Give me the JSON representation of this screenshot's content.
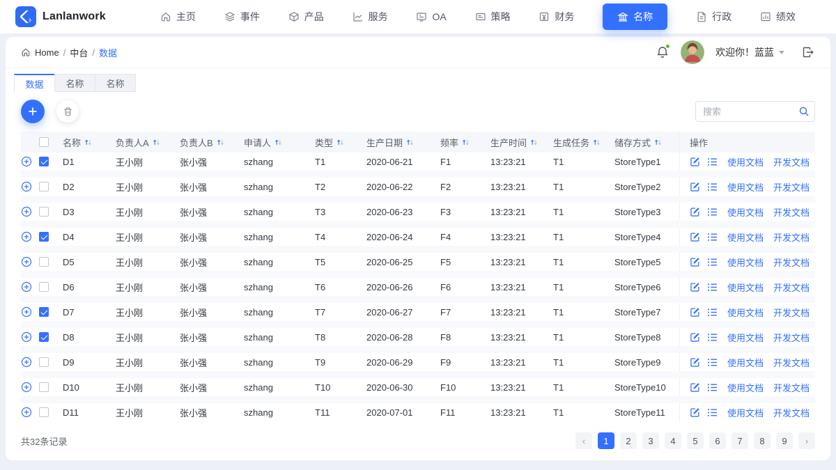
{
  "colors": {
    "primary": "#3370ff",
    "notification_dot": "#52c41a"
  },
  "brand": {
    "name": "Lanlanwork",
    "logo_icon": "brand-logo-icon"
  },
  "nav": {
    "items": [
      {
        "label": "主页",
        "icon": "home-icon",
        "active": false
      },
      {
        "label": "事件",
        "icon": "layers-icon",
        "active": false
      },
      {
        "label": "产品",
        "icon": "cube-icon",
        "active": false
      },
      {
        "label": "服务",
        "icon": "trend-icon",
        "active": false
      },
      {
        "label": "OA",
        "icon": "monitor-icon",
        "active": false
      },
      {
        "label": "策略",
        "icon": "note-icon",
        "active": false
      },
      {
        "label": "财务",
        "icon": "finance-icon",
        "active": false
      },
      {
        "label": "名称",
        "icon": "bank-icon",
        "active": true
      },
      {
        "label": "行政",
        "icon": "doc-icon",
        "active": false
      },
      {
        "label": "绩效",
        "icon": "stats-icon",
        "active": false
      }
    ]
  },
  "header": {
    "breadcrumb": {
      "home": "Home",
      "sep": "/",
      "section": "中台",
      "current": "数据"
    },
    "welcome": "欢迎你！蓝蓝"
  },
  "tabs": [
    {
      "label": "数据",
      "active": true
    },
    {
      "label": "名称",
      "active": false
    },
    {
      "label": "名称",
      "active": false
    }
  ],
  "toolbar": {
    "search_placeholder": "搜索"
  },
  "table": {
    "columns": [
      {
        "label": "名称",
        "sortable": true
      },
      {
        "label": "负责人A",
        "sortable": true
      },
      {
        "label": "负责人B",
        "sortable": true
      },
      {
        "label": "申请人",
        "sortable": true
      },
      {
        "label": "类型",
        "sortable": true
      },
      {
        "label": "生产日期",
        "sortable": true
      },
      {
        "label": "频率",
        "sortable": true
      },
      {
        "label": "生产时间",
        "sortable": true
      },
      {
        "label": "生成任务",
        "sortable": true
      },
      {
        "label": "储存方式",
        "sortable": true
      }
    ],
    "op_column": "操作",
    "op_links": [
      "使用文档",
      "开发文档"
    ],
    "rows": [
      {
        "checked": true,
        "name": "D1",
        "owner_a": "王小刚",
        "owner_b": "张小强",
        "applicant": "szhang",
        "type": "T1",
        "prod_date": "2020-06-21",
        "freq": "F1",
        "prod_time": "13:23:21",
        "task": "T1",
        "store": "StoreType1"
      },
      {
        "checked": false,
        "name": "D2",
        "owner_a": "王小刚",
        "owner_b": "张小强",
        "applicant": "szhang",
        "type": "T2",
        "prod_date": "2020-06-22",
        "freq": "F2",
        "prod_time": "13:23:21",
        "task": "T1",
        "store": "StoreType2"
      },
      {
        "checked": false,
        "name": "D3",
        "owner_a": "王小刚",
        "owner_b": "张小强",
        "applicant": "szhang",
        "type": "T3",
        "prod_date": "2020-06-23",
        "freq": "F3",
        "prod_time": "13:23:21",
        "task": "T1",
        "store": "StoreType3"
      },
      {
        "checked": true,
        "name": "D4",
        "owner_a": "王小刚",
        "owner_b": "张小强",
        "applicant": "szhang",
        "type": "T4",
        "prod_date": "2020-06-24",
        "freq": "F4",
        "prod_time": "13:23:21",
        "task": "T1",
        "store": "StoreType4"
      },
      {
        "checked": false,
        "name": "D5",
        "owner_a": "王小刚",
        "owner_b": "张小强",
        "applicant": "szhang",
        "type": "T5",
        "prod_date": "2020-06-25",
        "freq": "F5",
        "prod_time": "13:23:21",
        "task": "T1",
        "store": "StoreType5"
      },
      {
        "checked": false,
        "name": "D6",
        "owner_a": "王小刚",
        "owner_b": "张小强",
        "applicant": "szhang",
        "type": "T6",
        "prod_date": "2020-06-26",
        "freq": "F6",
        "prod_time": "13:23:21",
        "task": "T1",
        "store": "StoreType6"
      },
      {
        "checked": true,
        "name": "D7",
        "owner_a": "王小刚",
        "owner_b": "张小强",
        "applicant": "szhang",
        "type": "T7",
        "prod_date": "2020-06-27",
        "freq": "F7",
        "prod_time": "13:23:21",
        "task": "T1",
        "store": "StoreType7"
      },
      {
        "checked": true,
        "name": "D8",
        "owner_a": "王小刚",
        "owner_b": "张小强",
        "applicant": "szhang",
        "type": "T8",
        "prod_date": "2020-06-28",
        "freq": "F8",
        "prod_time": "13:23:21",
        "task": "T1",
        "store": "StoreType8"
      },
      {
        "checked": false,
        "name": "D9",
        "owner_a": "王小刚",
        "owner_b": "张小强",
        "applicant": "szhang",
        "type": "T9",
        "prod_date": "2020-06-29",
        "freq": "F9",
        "prod_time": "13:23:21",
        "task": "T1",
        "store": "StoreType9"
      },
      {
        "checked": false,
        "name": "D10",
        "owner_a": "王小刚",
        "owner_b": "张小强",
        "applicant": "szhang",
        "type": "T10",
        "prod_date": "2020-06-30",
        "freq": "F10",
        "prod_time": "13:23:21",
        "task": "T1",
        "store": "StoreType10"
      },
      {
        "checked": false,
        "name": "D11",
        "owner_a": "王小刚",
        "owner_b": "张小强",
        "applicant": "szhang",
        "type": "T11",
        "prod_date": "2020-07-01",
        "freq": "F11",
        "prod_time": "13:23:21",
        "task": "T1",
        "store": "StoreType11"
      }
    ]
  },
  "pagination": {
    "total_text": "共32条记录",
    "prev": "‹",
    "next": "›",
    "pages": [
      "1",
      "2",
      "3",
      "4",
      "5",
      "6",
      "7",
      "8",
      "9"
    ],
    "active": "1"
  }
}
